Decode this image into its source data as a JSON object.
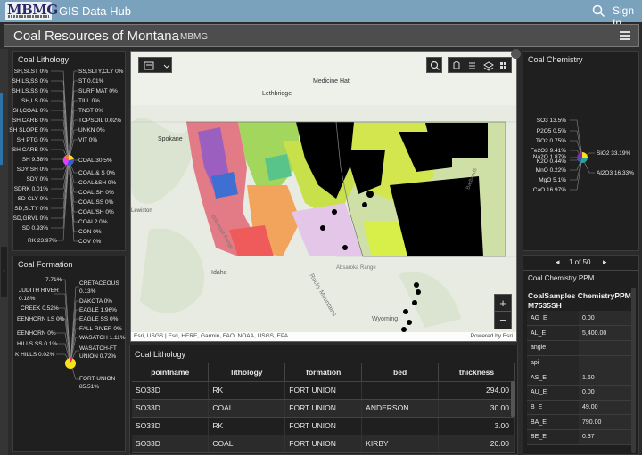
{
  "header": {
    "logo_text": "MBMG",
    "app_title": "GIS Data Hub",
    "signin_label": "Sign In",
    "page_title": "Coal Resources of Montana",
    "page_subtitle": "MBMG"
  },
  "lithology": {
    "title": "Coal Lithology",
    "left_labels": [
      "SH,SLST 0%",
      "SH,LS,SS 0%",
      "SH,LS,SS 0%",
      "SH,LS 0%",
      "SH,COAL 0%",
      "SH,CARB 0%",
      "SH SLOPE 0%",
      "SH PTG 0%",
      "SH CARB 0%",
      "SH 9.58%",
      "SDY SH 0%",
      "SDY 0%",
      "SDRK 0.01%",
      "SD-CLY 0%",
      "SD,SLTY 0%",
      "SD,GRVL 0%",
      "SD 0.93%",
      "RK 23.97%"
    ],
    "right_labels": [
      "SS,SLTY,CLY 0%",
      "ST 0.01%",
      "SURF MAT 0%",
      "TILL 0%",
      "TNST 0%",
      "TOPSOIL 0.02%",
      "UNKN 0%",
      "VIT 0%",
      "COAL 30.5%",
      "COAL & S 0%",
      "COAL&SH 0%",
      "COAL,SH 0%",
      "COAL,SS 0%",
      "COAL/SH 0%",
      "COAL? 0%",
      "CON 0%",
      "COV 0%"
    ]
  },
  "formation": {
    "title": "Coal Formation",
    "left_labels": [
      "7.71%",
      "JUDITH RIVER 0.18%",
      "CREEK 0.52%",
      "EENHORN LS 0%",
      "EENHORN 0%",
      "HILLS SS 0.1%",
      "K HILLS 0.02%"
    ],
    "right_labels": [
      "CRETACEOUS 0.13%",
      "DAKOTA 0%",
      "EAGLE 1.96%",
      "EAGLE SS 0%",
      "FALL RIVER 0%",
      "WASATCH 1.11%",
      "WASATCH-FT UNION 0.72%",
      "FORT UNION 85.51%"
    ]
  },
  "chemistry": {
    "title": "Coal Chemistry",
    "left_labels": [
      "SO3 13.5%",
      "P2O5 0.5%",
      "TiO2 0.75%",
      "Fe2O3 9.41%",
      "Na2O 1.87%",
      "K2O 0.44%",
      "MnO 0.22%",
      "MgO 5.1%",
      "CaO 16.97%"
    ],
    "right_labels": [
      "SiO2 33.19%",
      "Al2O3 16.33%"
    ]
  },
  "map": {
    "attribution": "Esri, USGS | Esri, HERE, Garmin, FAO, NOAA, USGS, EPA",
    "powered": "Powered by Esri",
    "places": [
      "Medicine Hat",
      "Lethbridge",
      "Spokane",
      "Idaho",
      "Wyoming",
      "Rocky Mountains",
      "Bitterroot Range",
      "Absaroka Range",
      "Badlands",
      "Lewiston"
    ]
  },
  "lith_table": {
    "title": "Coal Lithology",
    "columns": [
      "pointname",
      "lithology",
      "formation",
      "bed",
      "thickness"
    ],
    "rows": [
      [
        "SO33D",
        "RK",
        "FORT UNION",
        "",
        "294.00"
      ],
      [
        "SO33D",
        "COAL",
        "FORT UNION",
        "ANDERSON",
        "30.00"
      ],
      [
        "SO33D",
        "RK",
        "FORT UNION",
        "",
        "3.00"
      ],
      [
        "SO33D",
        "COAL",
        "FORT UNION",
        "KIRBY",
        "20.00"
      ]
    ]
  },
  "ppm": {
    "pager": "1 of 50",
    "title": "Coal Chemistry PPM",
    "record_title": "CoalSamples ChemistryPPM: M7535SH",
    "fields": [
      [
        "AG_E",
        "0.00"
      ],
      [
        "AL_E",
        "5,400.00"
      ],
      [
        "angle",
        ""
      ],
      [
        "api",
        ""
      ],
      [
        "AS_E",
        "1.60"
      ],
      [
        "AU_E",
        "0.00"
      ],
      [
        "B_E",
        "49.00"
      ],
      [
        "BA_E",
        "790.00"
      ],
      [
        "BE_E",
        "0.37"
      ]
    ]
  },
  "colors": {
    "topbar": "#7ba2bd",
    "panel": "#1f1f1f",
    "coal_yellow": "#f7e21b",
    "coal_points": "#000000"
  }
}
